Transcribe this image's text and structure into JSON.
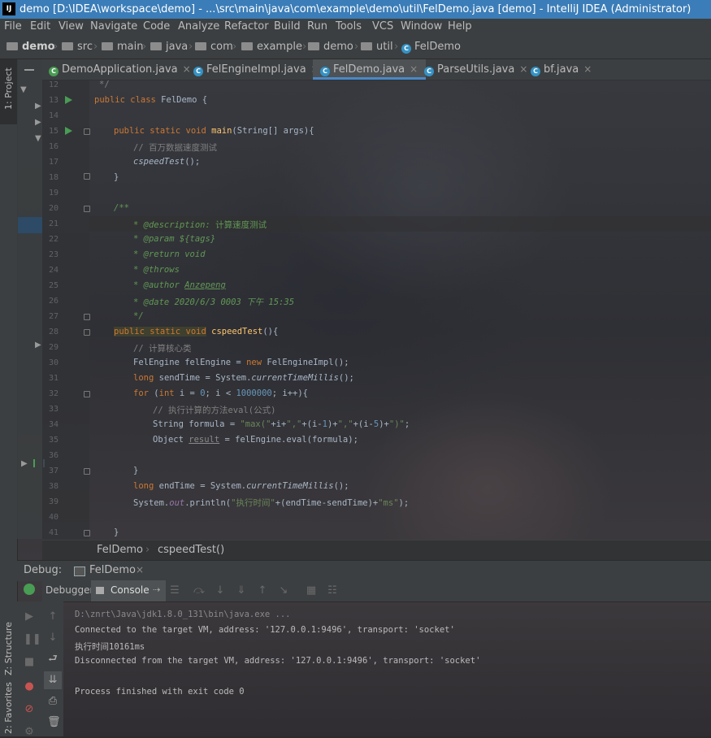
{
  "title_bar": {
    "logo": "IJ",
    "text": "demo [D:\\IDEA\\workspace\\demo] - ...\\src\\main\\java\\com\\example\\demo\\util\\FelDemo.java [demo] - IntelliJ IDEA (Administrator)"
  },
  "menu": [
    "File",
    "Edit",
    "View",
    "Navigate",
    "Code",
    "Analyze",
    "Refactor",
    "Build",
    "Run",
    "Tools",
    "VCS",
    "Window",
    "Help"
  ],
  "breadcrumb": [
    "demo",
    "src",
    "main",
    "java",
    "com",
    "example",
    "demo",
    "util",
    "FelDemo"
  ],
  "tool_windows": {
    "project": "1: Project",
    "structure": "Z: Structure",
    "favorites": "2: Favorites"
  },
  "tabs": [
    {
      "label": "DemoApplication.java",
      "active": false
    },
    {
      "label": "FelEngineImpl.java",
      "active": false
    },
    {
      "label": "FelDemo.java",
      "active": true
    },
    {
      "label": "ParseUtils.java",
      "active": false
    },
    {
      "label": "bf.java",
      "active": false
    }
  ],
  "code": {
    "line_numbers": [
      "12",
      "13",
      "14",
      "15",
      "16",
      "17",
      "18",
      "19",
      "20",
      "21",
      "22",
      "23",
      "24",
      "25",
      "26",
      "27",
      "28",
      "29",
      "30",
      "31",
      "32",
      "33",
      "34",
      "35",
      "36",
      "37",
      "38",
      "39",
      "40",
      "41"
    ],
    "l12": "*/",
    "l13_kw": "public class",
    "l13_name": " FelDemo {",
    "l15_kw": "public static void",
    "l15_fn": "main",
    "l15_rest": "(String[] args){",
    "l16": "// 百万数据速度测试",
    "l17_call": "cspeedTest",
    "l17_rest": "();",
    "l18": "}",
    "l20": "/**",
    "l21_tag": "* @description:",
    "l21_text": " 计算速度测试",
    "l22_tag": "* @param",
    "l22_text": " ${tags}",
    "l23_tag": "* @return",
    "l23_text": " void",
    "l24_tag": "* @throws",
    "l25_tag": "* @author",
    "l25_text": "Anzepeng",
    "l26_tag": "* @date",
    "l26_text": " 2020/6/3 0003 下午 15:35",
    "l27": "*/",
    "l28_kw": "public static void",
    "l28_fn": "cspeedTest",
    "l28_rest": "(){",
    "l29": "// 计算核心类",
    "l30_a": "FelEngine felEngine = ",
    "l30_kw": "new",
    "l30_b": " FelEngineImpl();",
    "l31_kw": "long",
    "l31_a": " sendTime = System.",
    "l31_it": "currentTimeMillis",
    "l31_b": "();",
    "l32_kw1": "for",
    "l32_a": " (",
    "l32_kw2": "int",
    "l32_b": " i = ",
    "l32_n0": "0",
    "l32_c": "; i < ",
    "l32_n1": "1000000",
    "l32_d": "; i++){",
    "l33": "// 执行计算的方法eval(公式)",
    "l34_a": "String formula = ",
    "l34_s1": "\"max(\"",
    "l34_b": "+i+",
    "l34_s2": "\",\"",
    "l34_c": "+(i-",
    "l34_n1": "1",
    "l34_d": ")+",
    "l34_s3": "\",\"",
    "l34_e": "+(i-",
    "l34_n2": "5",
    "l34_f": ")+",
    "l34_s4": "\")\"",
    "l34_g": ";",
    "l35_a": "Object ",
    "l35_var": "result",
    "l35_b": " = felEngine.eval(formula);",
    "l37": "}",
    "l38_kw": "long",
    "l38_a": " endTime = System.",
    "l38_it": "currentTimeMillis",
    "l38_b": "();",
    "l39_a": "System.",
    "l39_out": "out",
    "l39_b": ".println(",
    "l39_s1": "\"执行时间\"",
    "l39_c": "+(endTime-sendTime)+",
    "l39_s2": "\"ms\"",
    "l39_d": ");",
    "l41": "}"
  },
  "editor_breadcrumb": {
    "class": "FelDemo",
    "method": "cspeedTest()"
  },
  "debug": {
    "label": "Debug:",
    "session": "FelDemo",
    "tab_debugger": "Debugger",
    "tab_console": "Console"
  },
  "console_lines": [
    "D:\\znrt\\Java\\jdk1.8.0_131\\bin\\java.exe ...",
    "Connected to the target VM, address: '127.0.0.1:9496', transport: 'socket'",
    "执行时间10161ms",
    "Disconnected from the target VM, address: '127.0.0.1:9496', transport: 'socket'",
    "",
    "Process finished with exit code 0"
  ]
}
